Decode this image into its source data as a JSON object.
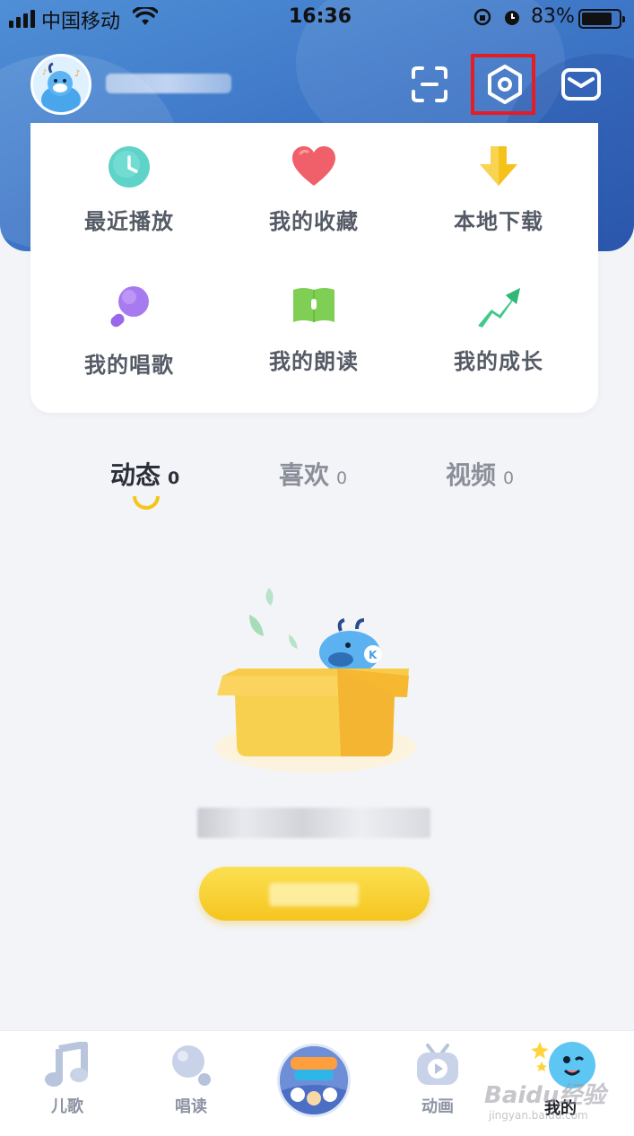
{
  "status_bar": {
    "carrier": "中国移动",
    "time": "16:36",
    "battery_percent": "83%",
    "battery_level": 0.83
  },
  "header": {
    "icons": [
      "scan-icon",
      "settings-icon",
      "mail-icon"
    ],
    "highlight_color": "#e51c23"
  },
  "quick_menu": {
    "items": [
      {
        "label": "最近播放",
        "icon": "clock-icon",
        "color": "#5fd3c8"
      },
      {
        "label": "我的收藏",
        "icon": "heart-icon",
        "color": "#f0606a"
      },
      {
        "label": "本地下载",
        "icon": "download-arrow-icon",
        "color": "#f5c21b"
      },
      {
        "label": "我的唱歌",
        "icon": "microphone-icon",
        "color": "#a77af0"
      },
      {
        "label": "我的朗读",
        "icon": "book-icon",
        "color": "#7fcf54"
      },
      {
        "label": "我的成长",
        "icon": "growth-arrow-icon",
        "color": "#44c98a"
      }
    ]
  },
  "tabs": [
    {
      "label": "动态",
      "count": "0",
      "active": true
    },
    {
      "label": "喜欢",
      "count": "0",
      "active": false
    },
    {
      "label": "视频",
      "count": "0",
      "active": false
    }
  ],
  "bottom_nav": {
    "items": [
      {
        "label": "儿歌",
        "icon": "music-note-icon"
      },
      {
        "label": "唱读",
        "icon": "microphone-icon"
      },
      {
        "label": "",
        "icon": "center-badge-icon"
      },
      {
        "label": "动画",
        "icon": "tv-play-icon"
      },
      {
        "label": "我的",
        "icon": "mascot-icon"
      }
    ]
  },
  "watermark": {
    "text": "Baidu经验",
    "url": "jingyan.baidu.com"
  },
  "accent": "#f5c518"
}
